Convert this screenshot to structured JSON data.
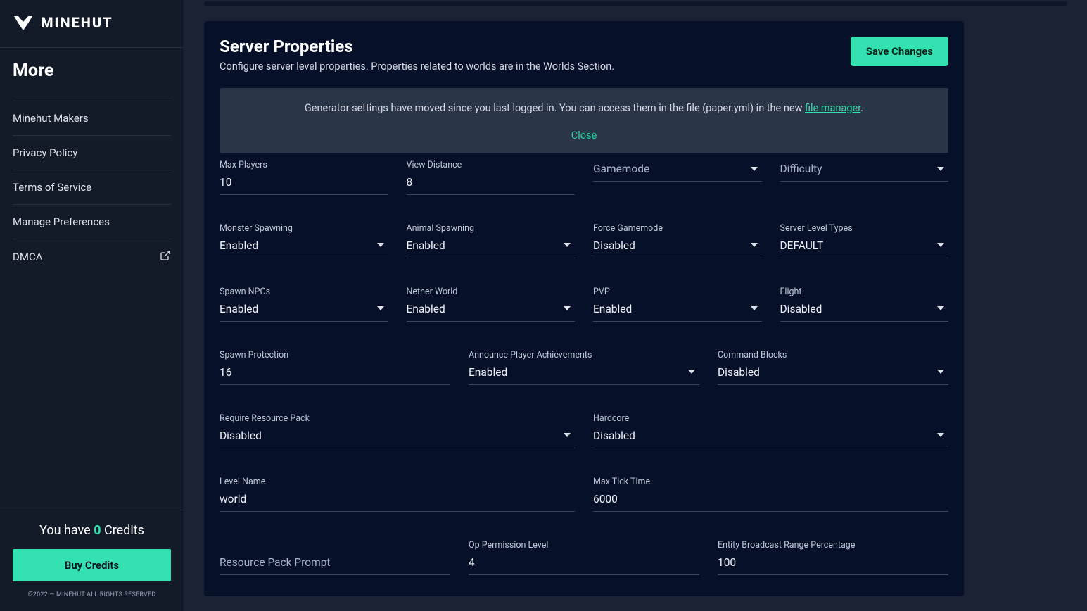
{
  "brand": {
    "name": "MINEHUT"
  },
  "sidebar": {
    "section": "More",
    "items": [
      {
        "label": "Minehut Makers",
        "external": false
      },
      {
        "label": "Privacy Policy",
        "external": false
      },
      {
        "label": "Terms of Service",
        "external": false
      },
      {
        "label": "Manage Preferences",
        "external": false
      },
      {
        "label": "DMCA",
        "external": true
      }
    ],
    "credits": {
      "prefix": "You have ",
      "count": "0",
      "suffix": " Credits"
    },
    "buy_label": "Buy Credits",
    "copyright": "©2022 — MINEHUT ALL RIGHTS RESERVED"
  },
  "header": {
    "title": "Server Properties",
    "subtitle": "Configure server level properties. Properties related to worlds are in the Worlds Section.",
    "save_label": "Save Changes"
  },
  "notice": {
    "text_before": "Generator settings have moved since you last logged in. You can access them in the file (paper.yml) in the new ",
    "link_text": "file manager",
    "text_after": ".",
    "close_label": "Close"
  },
  "fields": {
    "max_players": {
      "label": "Max Players",
      "value": "10"
    },
    "view_distance": {
      "label": "View Distance",
      "value": "8"
    },
    "gamemode": {
      "label": "Gamemode"
    },
    "difficulty": {
      "label": "Difficulty"
    },
    "monster_spawning": {
      "label": "Monster Spawning",
      "value": "Enabled"
    },
    "animal_spawning": {
      "label": "Animal Spawning",
      "value": "Enabled"
    },
    "force_gamemode": {
      "label": "Force Gamemode",
      "value": "Disabled"
    },
    "server_level_types": {
      "label": "Server Level Types",
      "value": "DEFAULT"
    },
    "spawn_npcs": {
      "label": "Spawn NPCs",
      "value": "Enabled"
    },
    "nether_world": {
      "label": "Nether World",
      "value": "Enabled"
    },
    "pvp": {
      "label": "PVP",
      "value": "Enabled"
    },
    "flight": {
      "label": "Flight",
      "value": "Disabled"
    },
    "spawn_protection": {
      "label": "Spawn Protection",
      "value": "16"
    },
    "announce": {
      "label": "Announce Player Achievements",
      "value": "Enabled"
    },
    "command_blocks": {
      "label": "Command Blocks",
      "value": "Disabled"
    },
    "require_rp": {
      "label": "Require Resource Pack",
      "value": "Disabled"
    },
    "hardcore": {
      "label": "Hardcore",
      "value": "Disabled"
    },
    "level_name": {
      "label": "Level Name",
      "value": "world"
    },
    "max_tick_time": {
      "label": "Max Tick Time",
      "value": "6000"
    },
    "rp_prompt": {
      "label": "Resource Pack Prompt"
    },
    "op_level": {
      "label": "Op Permission Level",
      "value": "4"
    },
    "entity_range": {
      "label": "Entity Broadcast Range Percentage",
      "value": "100"
    }
  }
}
